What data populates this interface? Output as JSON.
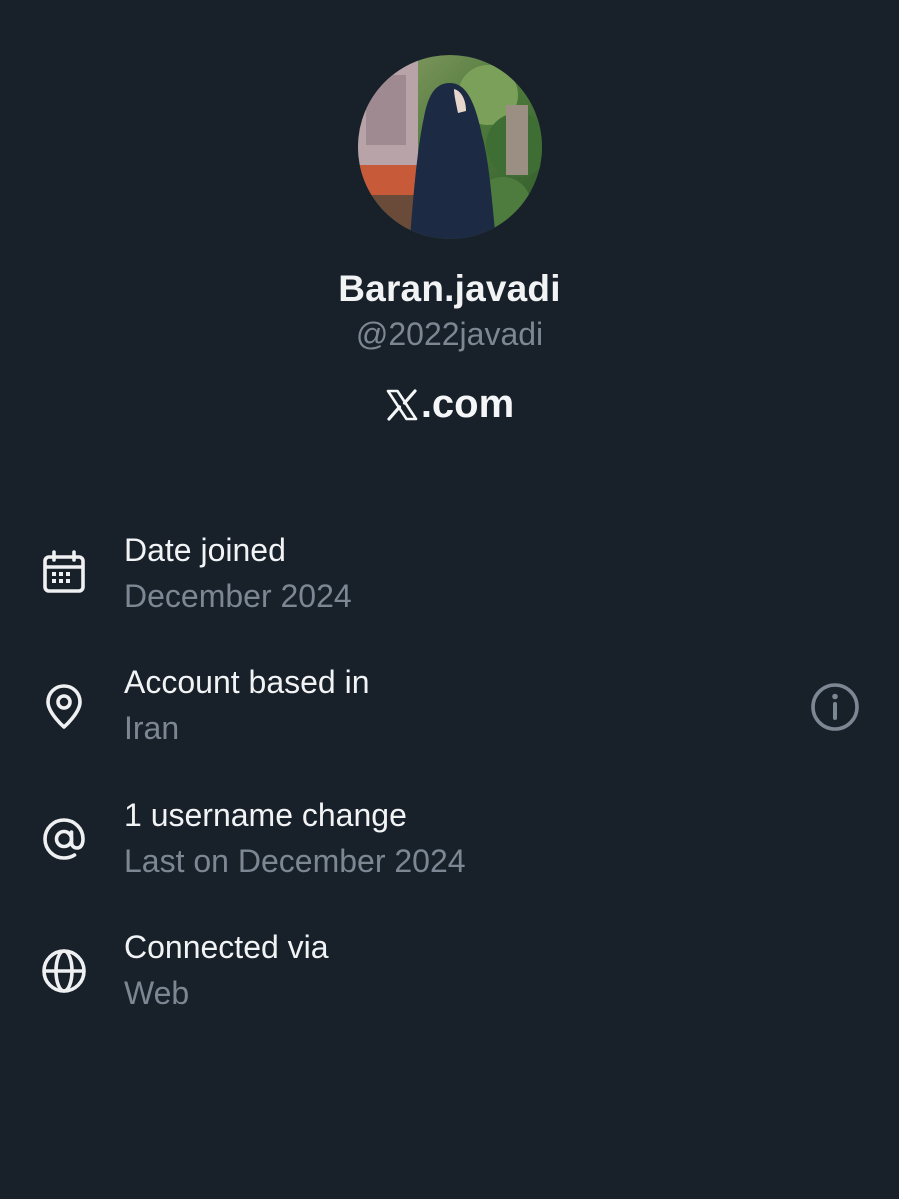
{
  "profile": {
    "display_name": "Baran.javadi",
    "handle": "@2022javadi",
    "site": ".com",
    "avatar_icon": "profile-photo"
  },
  "details": [
    {
      "label": "Date joined",
      "value": "December 2024",
      "icon": "calendar-icon"
    },
    {
      "label": "Account based in",
      "value": "Iran",
      "icon": "location-pin-icon"
    },
    {
      "label": "1 username change",
      "value": "Last on December 2024",
      "icon": "at-sign-icon"
    },
    {
      "label": "Connected via",
      "value": "Web",
      "icon": "globe-icon"
    }
  ],
  "colors": {
    "background": "#18202a",
    "primary_text": "#f1f3f4",
    "secondary_text": "#7c8793"
  }
}
